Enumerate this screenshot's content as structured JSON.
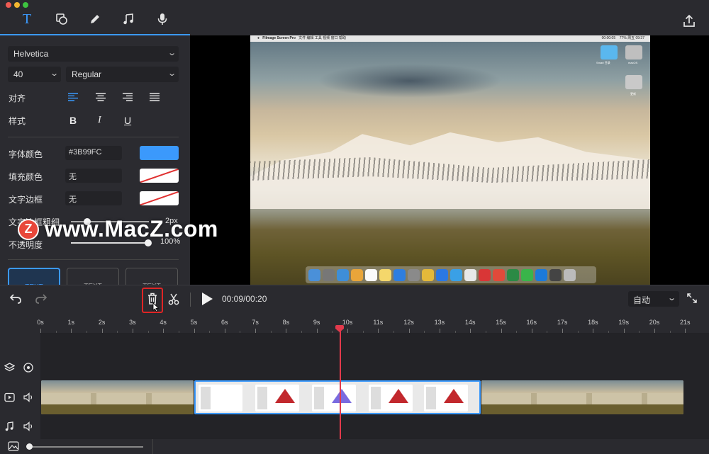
{
  "toolbar": {
    "tabs": [
      "text-tool",
      "shape-tool",
      "pen-tool",
      "music-tool",
      "mic-tool"
    ],
    "export_icon": "upload-icon"
  },
  "text_panel": {
    "font_family": "Helvetica",
    "font_size": "40",
    "font_weight": "Regular",
    "align_label": "对齐",
    "style_label": "样式",
    "style_bold": "B",
    "style_italic": "I",
    "style_underline": "U",
    "font_color_label": "字体颜色",
    "font_color_value": "#3B99FC",
    "fill_color_label": "填充颜色",
    "fill_color_value": "无",
    "border_label": "文字边框",
    "border_value": "无",
    "border_width_label": "文字边框粗细",
    "border_width_value": "2px",
    "opacity_label": "不透明度",
    "opacity_value": "100%",
    "opacity_level": 1.0,
    "presets": [
      "TEXT",
      "TEXT",
      "TEXT"
    ]
  },
  "watermark": {
    "logo": "Z",
    "text": "www.MacZ.com"
  },
  "preview": {
    "menubar_app": "Filmage Screen Pro",
    "menubar_items": "文件   编辑   工具   视频   窗口   帮助",
    "menubar_time": "00:00:05",
    "menubar_clock": "77%   周五 09:37",
    "desktop_icons": [
      "Smart 目录",
      "macOS",
      "更新"
    ]
  },
  "controls": {
    "undo_icon": "undo-icon",
    "redo_icon": "redo-icon",
    "delete_icon": "trash-icon",
    "cut_icon": "scissors-icon",
    "play_icon": "play-icon",
    "time": "00:09/00:20",
    "zoom_mode": "自动",
    "fullscreen_icon": "expand-icon"
  },
  "ruler": {
    "labels": [
      "0s",
      "1s",
      "2s",
      "3s",
      "4s",
      "5s",
      "6s",
      "7s",
      "8s",
      "9s",
      "10s",
      "11s",
      "12s",
      "13s",
      "14s",
      "15s",
      "16s",
      "17s",
      "18s",
      "19s",
      "20s",
      "21s"
    ]
  },
  "colors": {
    "accent": "#3B99FC",
    "playhead": "#E23A4C",
    "highlight": "#E02525"
  }
}
